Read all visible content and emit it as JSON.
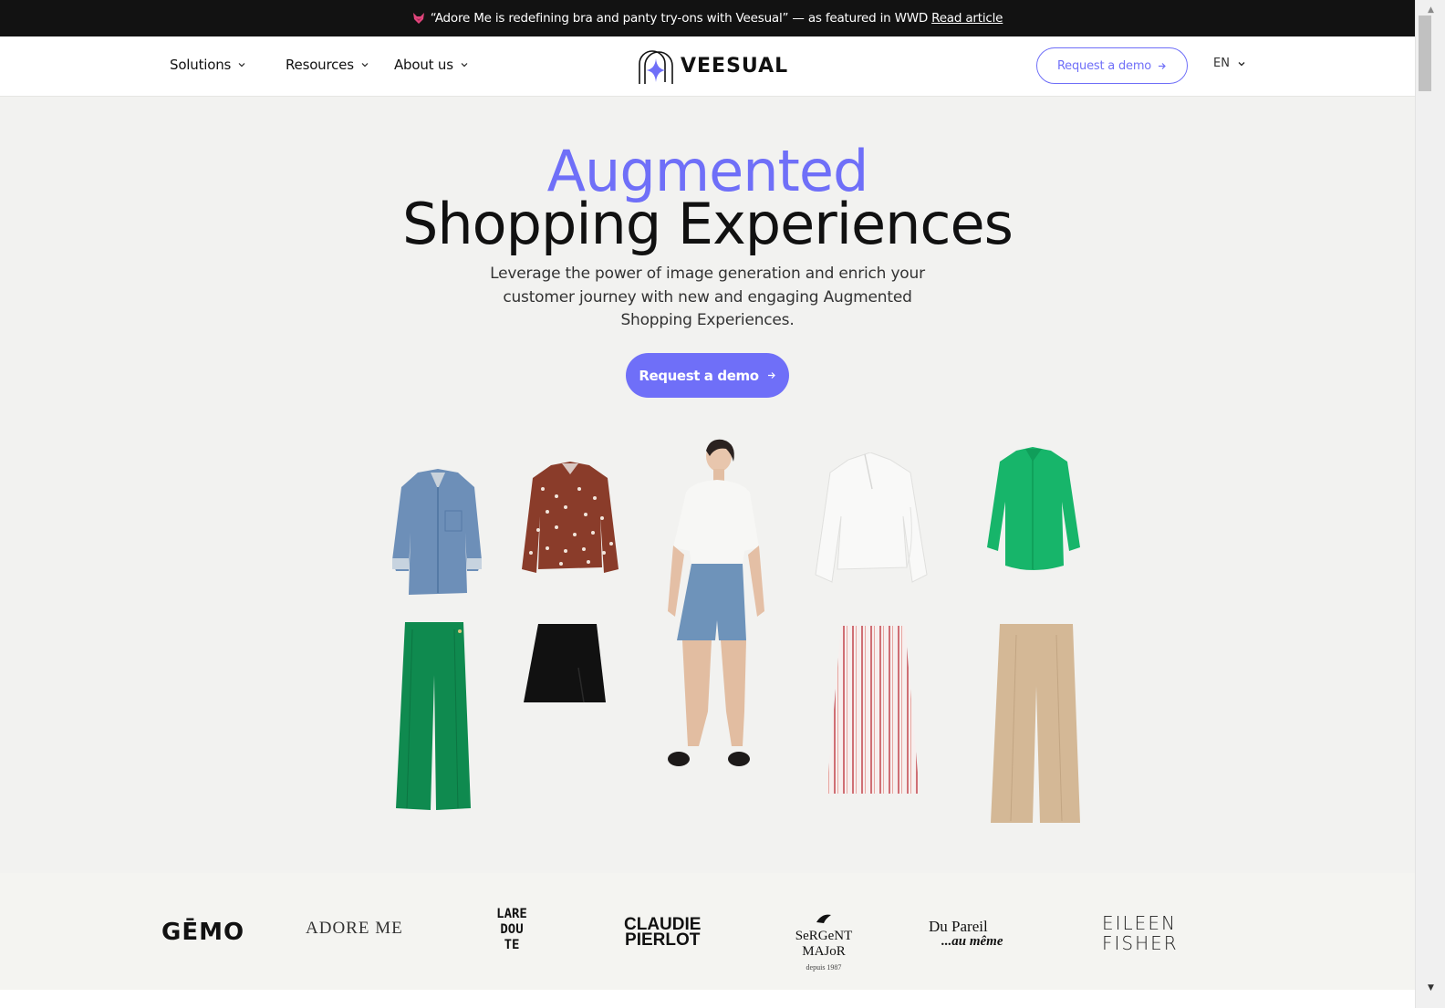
{
  "announcement": {
    "text": "“Adore Me is redefining bra and panty try-ons with Veesual” — as featured in WWD",
    "link_label": "Read article"
  },
  "header": {
    "nav": [
      {
        "label": "Solutions"
      },
      {
        "label": "Resources"
      },
      {
        "label": "About us"
      }
    ],
    "logo_text": "VEESUAL",
    "cta_label": "Request a demo",
    "language": "EN"
  },
  "hero": {
    "title_accent": "Augmented",
    "title_main": "Shopping Experiences",
    "subtitle": "Leverage the power of image generation and enrich your customer journey with new and engaging Augmented Shopping Experiences.",
    "cta_label": "Request a demo"
  },
  "gallery": {
    "items": [
      {
        "name": "Denim shirt"
      },
      {
        "name": "Brown polka dot blouse"
      },
      {
        "name": "Model wearing white t-shirt and denim shorts"
      },
      {
        "name": "White ruffle blouse"
      },
      {
        "name": "Green shirt"
      },
      {
        "name": "Green wide-leg trousers"
      },
      {
        "name": "Black mini skirt"
      },
      {
        "name": "Pink striped midi skirt"
      },
      {
        "name": "Beige wide-leg trousers"
      }
    ]
  },
  "brands": {
    "gemo": "GĒMO",
    "adore_me": "ADORE ME",
    "la_redoute": [
      "LARE",
      "DOU",
      "TE"
    ],
    "claudie_pierlot": [
      "CLAUDIE",
      "PIERLOT"
    ],
    "sergent_major": "SeRGeNT MAJoR",
    "sergent_major_sub": "depuis 1987",
    "du_pareil": "Du Pareil",
    "du_pareil_script": "...au même",
    "eileen_fisher": [
      "EILEEN",
      "FISHER"
    ]
  },
  "colors": {
    "accent": "#6f6ff8",
    "announcement_bg": "#121212",
    "page_bg": "#f2f2f0"
  }
}
